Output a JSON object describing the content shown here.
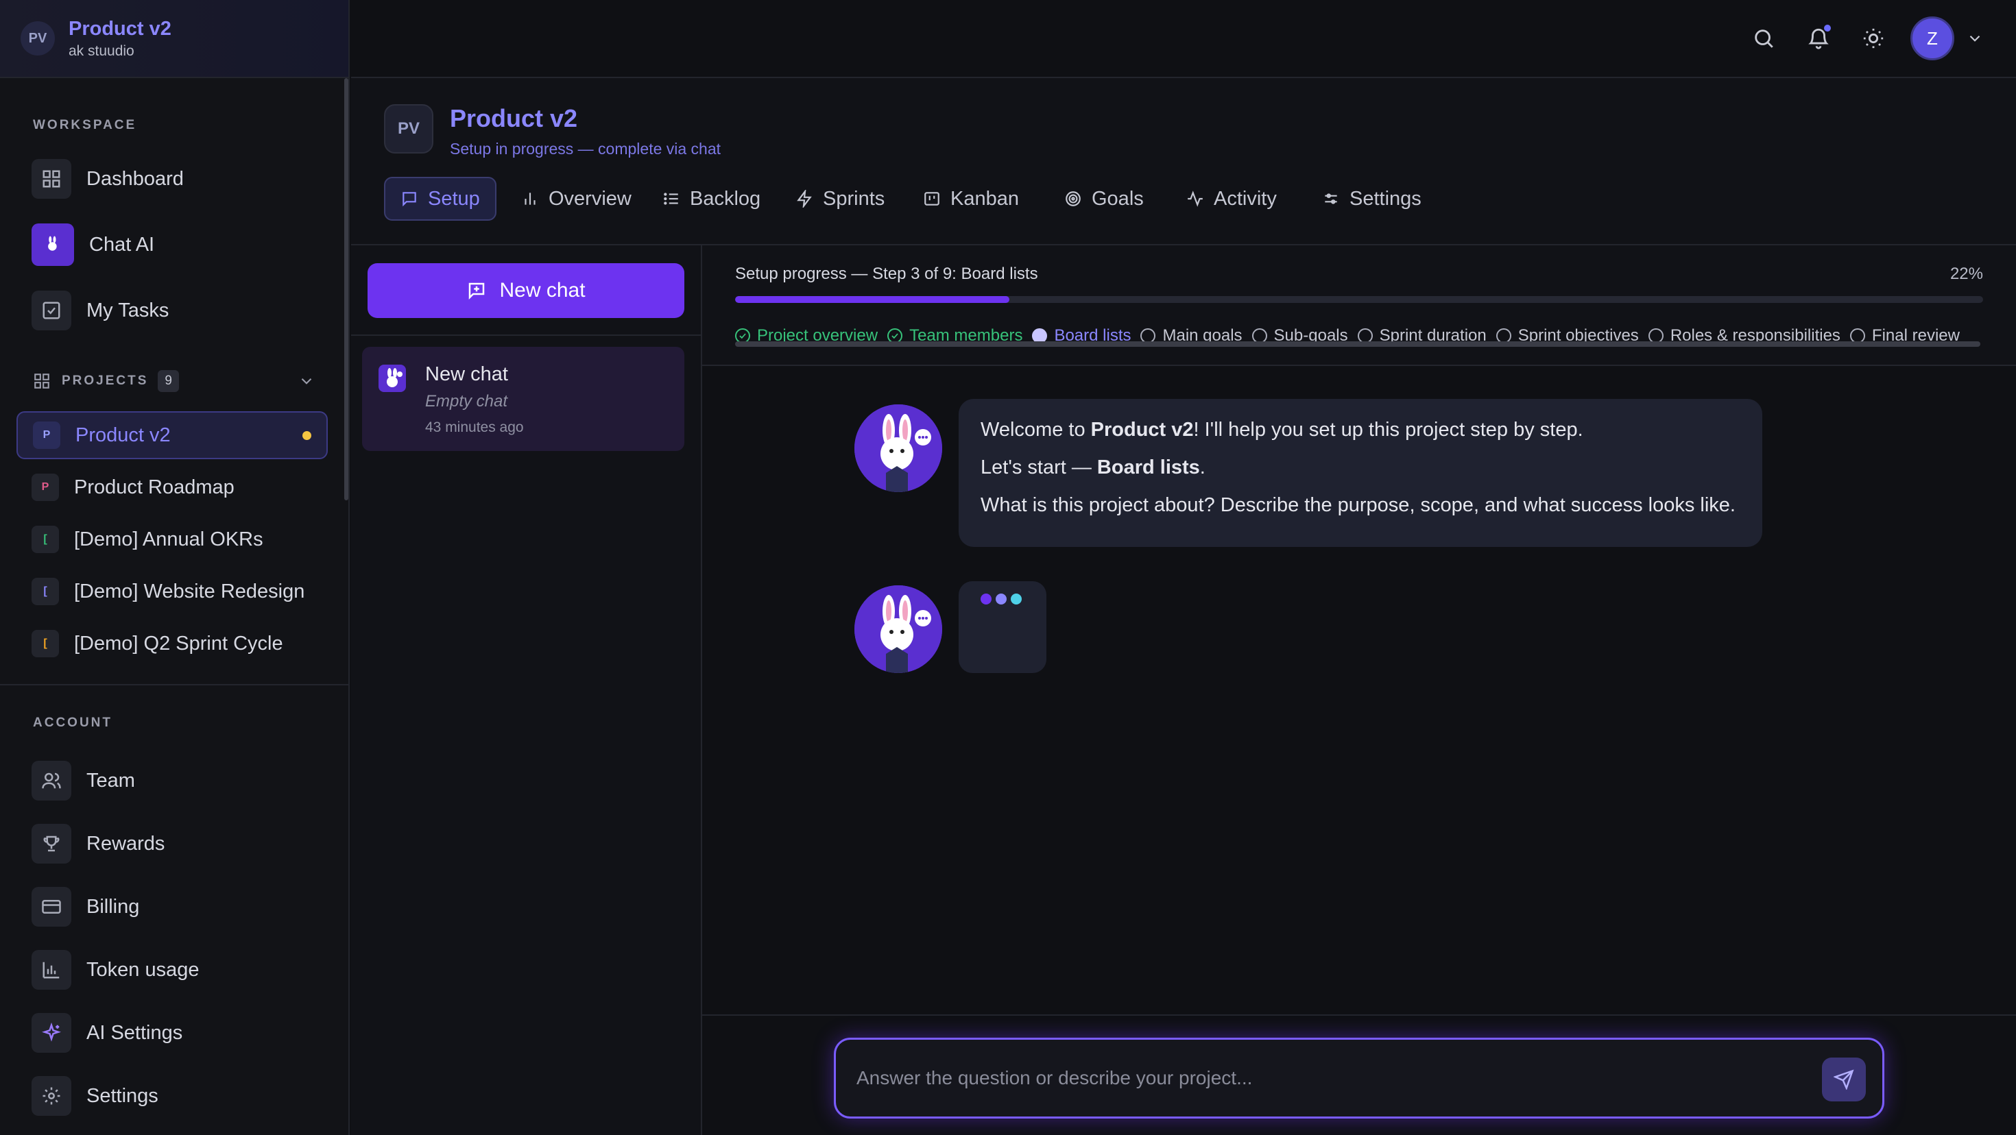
{
  "brand": {
    "initials": "PV",
    "title": "Product v2",
    "subtitle": "ak stuudio"
  },
  "sidebar": {
    "workspace_label": "WORKSPACE",
    "workspace_items": [
      {
        "label": "Dashboard",
        "icon": "grid-icon"
      },
      {
        "label": "Chat AI",
        "icon": "bunny-icon"
      },
      {
        "label": "My Tasks",
        "icon": "checkbox-icon"
      }
    ],
    "projects_label": "PROJECTS",
    "projects_count": "9",
    "projects": [
      {
        "badge": "P",
        "label": "Product v2",
        "badge_color": "#9aa0ff",
        "active": true
      },
      {
        "badge": "P",
        "label": "Product Roadmap",
        "badge_color": "#e05a8a"
      },
      {
        "badge": "[",
        "label": "[Demo] Annual OKRs",
        "badge_color": "#37c27a"
      },
      {
        "badge": "[",
        "label": "[Demo] Website Redesign",
        "badge_color": "#8b87ff"
      },
      {
        "badge": "[",
        "label": "[Demo] Q2 Sprint Cycle",
        "badge_color": "#f5a623"
      }
    ],
    "account_label": "ACCOUNT",
    "account_items": [
      {
        "label": "Team",
        "icon": "users-icon"
      },
      {
        "label": "Rewards",
        "icon": "trophy-icon"
      },
      {
        "label": "Billing",
        "icon": "credit-card-icon"
      },
      {
        "label": "Token usage",
        "icon": "bar-chart-icon"
      },
      {
        "label": "AI Settings",
        "icon": "sparkle-icon"
      },
      {
        "label": "Settings",
        "icon": "gear-icon"
      }
    ]
  },
  "header": {
    "user_initial": "Z"
  },
  "project": {
    "initials": "PV",
    "title": "Product v2",
    "subtitle": "Setup in progress — complete via chat",
    "tabs": [
      {
        "label": "Setup",
        "icon": "chat-icon",
        "active": true
      },
      {
        "label": "Overview",
        "icon": "bar-chart-icon"
      },
      {
        "label": "Backlog",
        "icon": "list-icon"
      },
      {
        "label": "Sprints",
        "icon": "lightning-icon"
      },
      {
        "label": "Kanban",
        "icon": "kanban-icon"
      },
      {
        "label": "Goals",
        "icon": "target-icon"
      },
      {
        "label": "Activity",
        "icon": "activity-icon"
      },
      {
        "label": "Settings",
        "icon": "sliders-icon"
      }
    ]
  },
  "chatlist": {
    "new_chat_label": "New chat",
    "chats": [
      {
        "title": "New chat",
        "subtitle": "Empty chat",
        "time": "43 minutes ago"
      }
    ]
  },
  "progress": {
    "label": "Setup progress — Step 3 of 9: Board lists",
    "percent_label": "22%",
    "percent": 22,
    "steps": [
      {
        "label": "Project overview",
        "state": "done"
      },
      {
        "label": "Team members",
        "state": "done"
      },
      {
        "label": "Board lists",
        "state": "current"
      },
      {
        "label": "Main goals",
        "state": "pending"
      },
      {
        "label": "Sub-goals",
        "state": "pending"
      },
      {
        "label": "Sprint duration",
        "state": "pending"
      },
      {
        "label": "Sprint objectives",
        "state": "pending"
      },
      {
        "label": "Roles & responsibilities",
        "state": "pending"
      },
      {
        "label": "Final review",
        "state": "pending"
      }
    ]
  },
  "message": {
    "line1_prefix": "Welcome to ",
    "line1_bold": "Product v2",
    "line1_suffix": "! I'll help you set up this project step by step.",
    "line2_prefix": "Let's start — ",
    "line2_bold": "Board lists",
    "line2_suffix": ".",
    "line3": "What is this project about? Describe the purpose, scope, and what success looks like."
  },
  "typing_colors": [
    "#6d33f0",
    "#8b87ff",
    "#4fd1e8"
  ],
  "composer": {
    "placeholder": "Answer the question or describe your project..."
  },
  "colors": {
    "accent": "#6d33f0",
    "link": "#8b87ff",
    "done": "#37c27a",
    "dot": "#f5c542"
  }
}
